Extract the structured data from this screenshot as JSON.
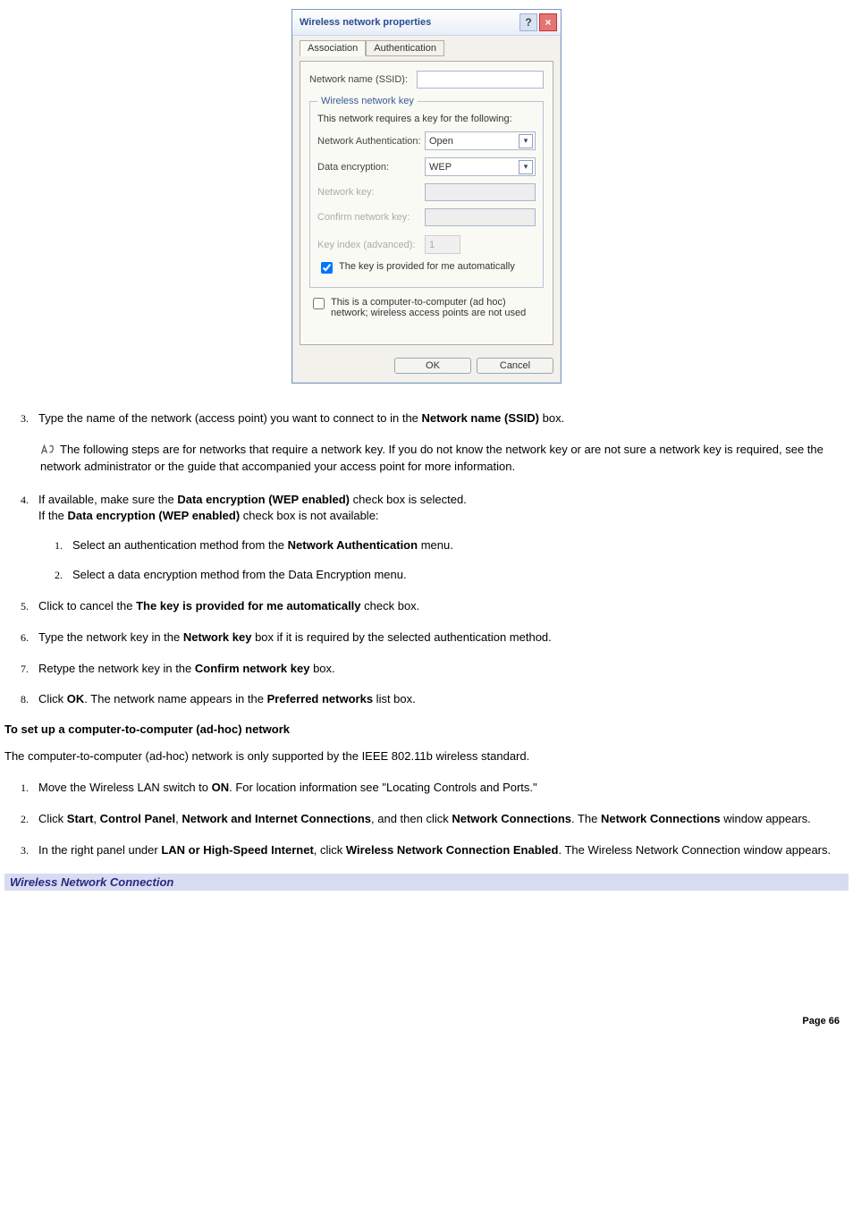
{
  "dialog": {
    "title": "Wireless network properties",
    "tabs": {
      "assoc": "Association",
      "auth": "Authentication"
    },
    "ssid_label": "Network name (SSID):",
    "group_legend": "Wireless network key",
    "group_desc": "This network requires a key for the following:",
    "auth_label": "Network Authentication:",
    "auth_value": "Open",
    "enc_label": "Data encryption:",
    "enc_value": "WEP",
    "key_label": "Network key:",
    "confirm_label": "Confirm network key:",
    "index_label": "Key index (advanced):",
    "index_value": "1",
    "auto_label": "The key is provided for me automatically",
    "adhoc_label": "This is a computer-to-computer (ad hoc) network; wireless access points are not used",
    "ok": "OK",
    "cancel": "Cancel"
  },
  "steps": {
    "s3_a": "Type the name of the network (access point) you want to connect to in the ",
    "s3_b": "Network name (SSID)",
    "s3_c": " box.",
    "note": "The following steps are for networks that require a network key. If you do not know the network key or are not sure a network key is required, see the network administrator or the guide that accompanied your access point for more information.",
    "s4_a": "If available, make sure the ",
    "s4_b": "Data encryption (WEP enabled)",
    "s4_c": " check box is selected.",
    "s4_d": "If the ",
    "s4_e": "Data encryption (WEP enabled)",
    "s4_f": " check box is not available:",
    "s4_1a": "Select an authentication method from the ",
    "s4_1b": "Network Authentication",
    "s4_1c": " menu.",
    "s4_2": "Select a data encryption method from the Data Encryption menu.",
    "s5_a": "Click to cancel the ",
    "s5_b": "The key is provided for me automatically",
    "s5_c": " check box.",
    "s6_a": "Type the network key in the ",
    "s6_b": "Network key",
    "s6_c": " box if it is required by the selected authentication method.",
    "s7_a": "Retype the network key in the ",
    "s7_b": "Confirm network key",
    "s7_c": " box.",
    "s8_a": "Click ",
    "s8_b": "OK",
    "s8_c": ". The network name appears in the ",
    "s8_d": "Preferred networks",
    "s8_e": " list box."
  },
  "adhoc": {
    "heading": "To set up a computer-to-computer (ad-hoc) network",
    "intro": "The computer-to-computer (ad-hoc) network is only supported by the IEEE 802.11b wireless standard.",
    "s1_a": "Move the Wireless LAN switch to ",
    "s1_b": "ON",
    "s1_c": ". For location information see \"Locating Controls and Ports.\"",
    "s2_a": "Click ",
    "s2_b": "Start",
    "s2_c": ", ",
    "s2_d": "Control Panel",
    "s2_e": ", ",
    "s2_f": "Network and Internet Connections",
    "s2_g": ", and then click ",
    "s2_h": "Network Connections",
    "s2_i": ". The ",
    "s2_j": "Network Connections",
    "s2_k": " window appears.",
    "s3_a": "In the right panel under ",
    "s3_b": "LAN or High-Speed Internet",
    "s3_c": ", click ",
    "s3_d": "Wireless Network Connection Enabled",
    "s3_e": ". The Wireless Network Connection window appears."
  },
  "caption": "Wireless Network Connection",
  "page_number": "Page 66"
}
